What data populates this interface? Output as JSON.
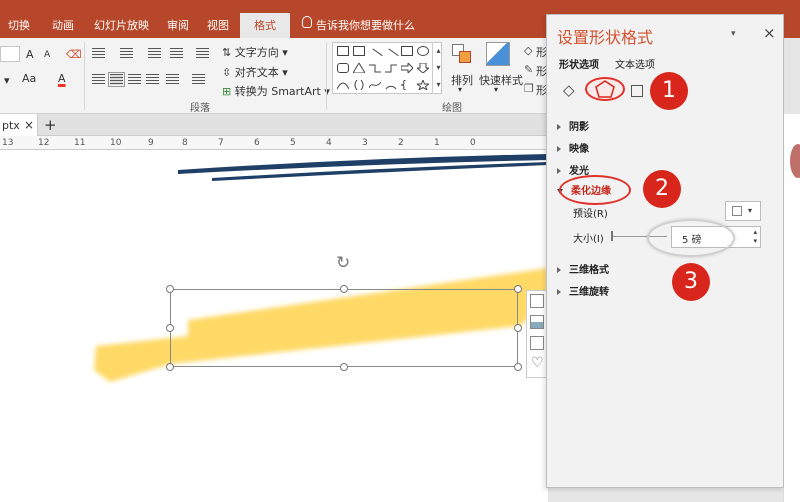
{
  "ribbon_tabs": [
    "切换",
    "动画",
    "幻灯片放映",
    "审阅",
    "视图",
    "格式"
  ],
  "tell_me": "告诉我你想要做什么",
  "ribbon": {
    "text_direction": "文字方向",
    "align_text": "对齐文本",
    "convert_smartart": "转换为 SmartArt",
    "font_size_grow": "A",
    "case_label": "Aa",
    "font_color": "A",
    "arrange": "排列",
    "quick_styles": "快速样式",
    "paragraph_group": "段落",
    "drawing_group": "绘图",
    "partial_labels": [
      "形",
      "形",
      "形"
    ]
  },
  "doc_tab": {
    "name": "ptx",
    "close": "×",
    "add": "+"
  },
  "ruler_ticks": [
    "13",
    "12",
    "11",
    "10",
    "9",
    "8",
    "7",
    "6",
    "5",
    "4",
    "3",
    "2",
    "1",
    "0"
  ],
  "pane": {
    "title": "设置形状格式",
    "tabs": [
      "形状选项",
      "文本选项"
    ],
    "sections": [
      "阴影",
      "映像",
      "发光",
      "柔化边缘",
      "三维格式",
      "三维旋转"
    ],
    "preset_label": "预设(R)",
    "size_label": "大小(I)",
    "size_value": "5 磅"
  },
  "markers": [
    "1",
    "2",
    "3"
  ],
  "colors": {
    "accent": "#b7472a",
    "pane_title": "#d35230",
    "marker": "#d9261c",
    "brush_yellow": "#ffd966",
    "brush_blue": "#1f3f66"
  }
}
